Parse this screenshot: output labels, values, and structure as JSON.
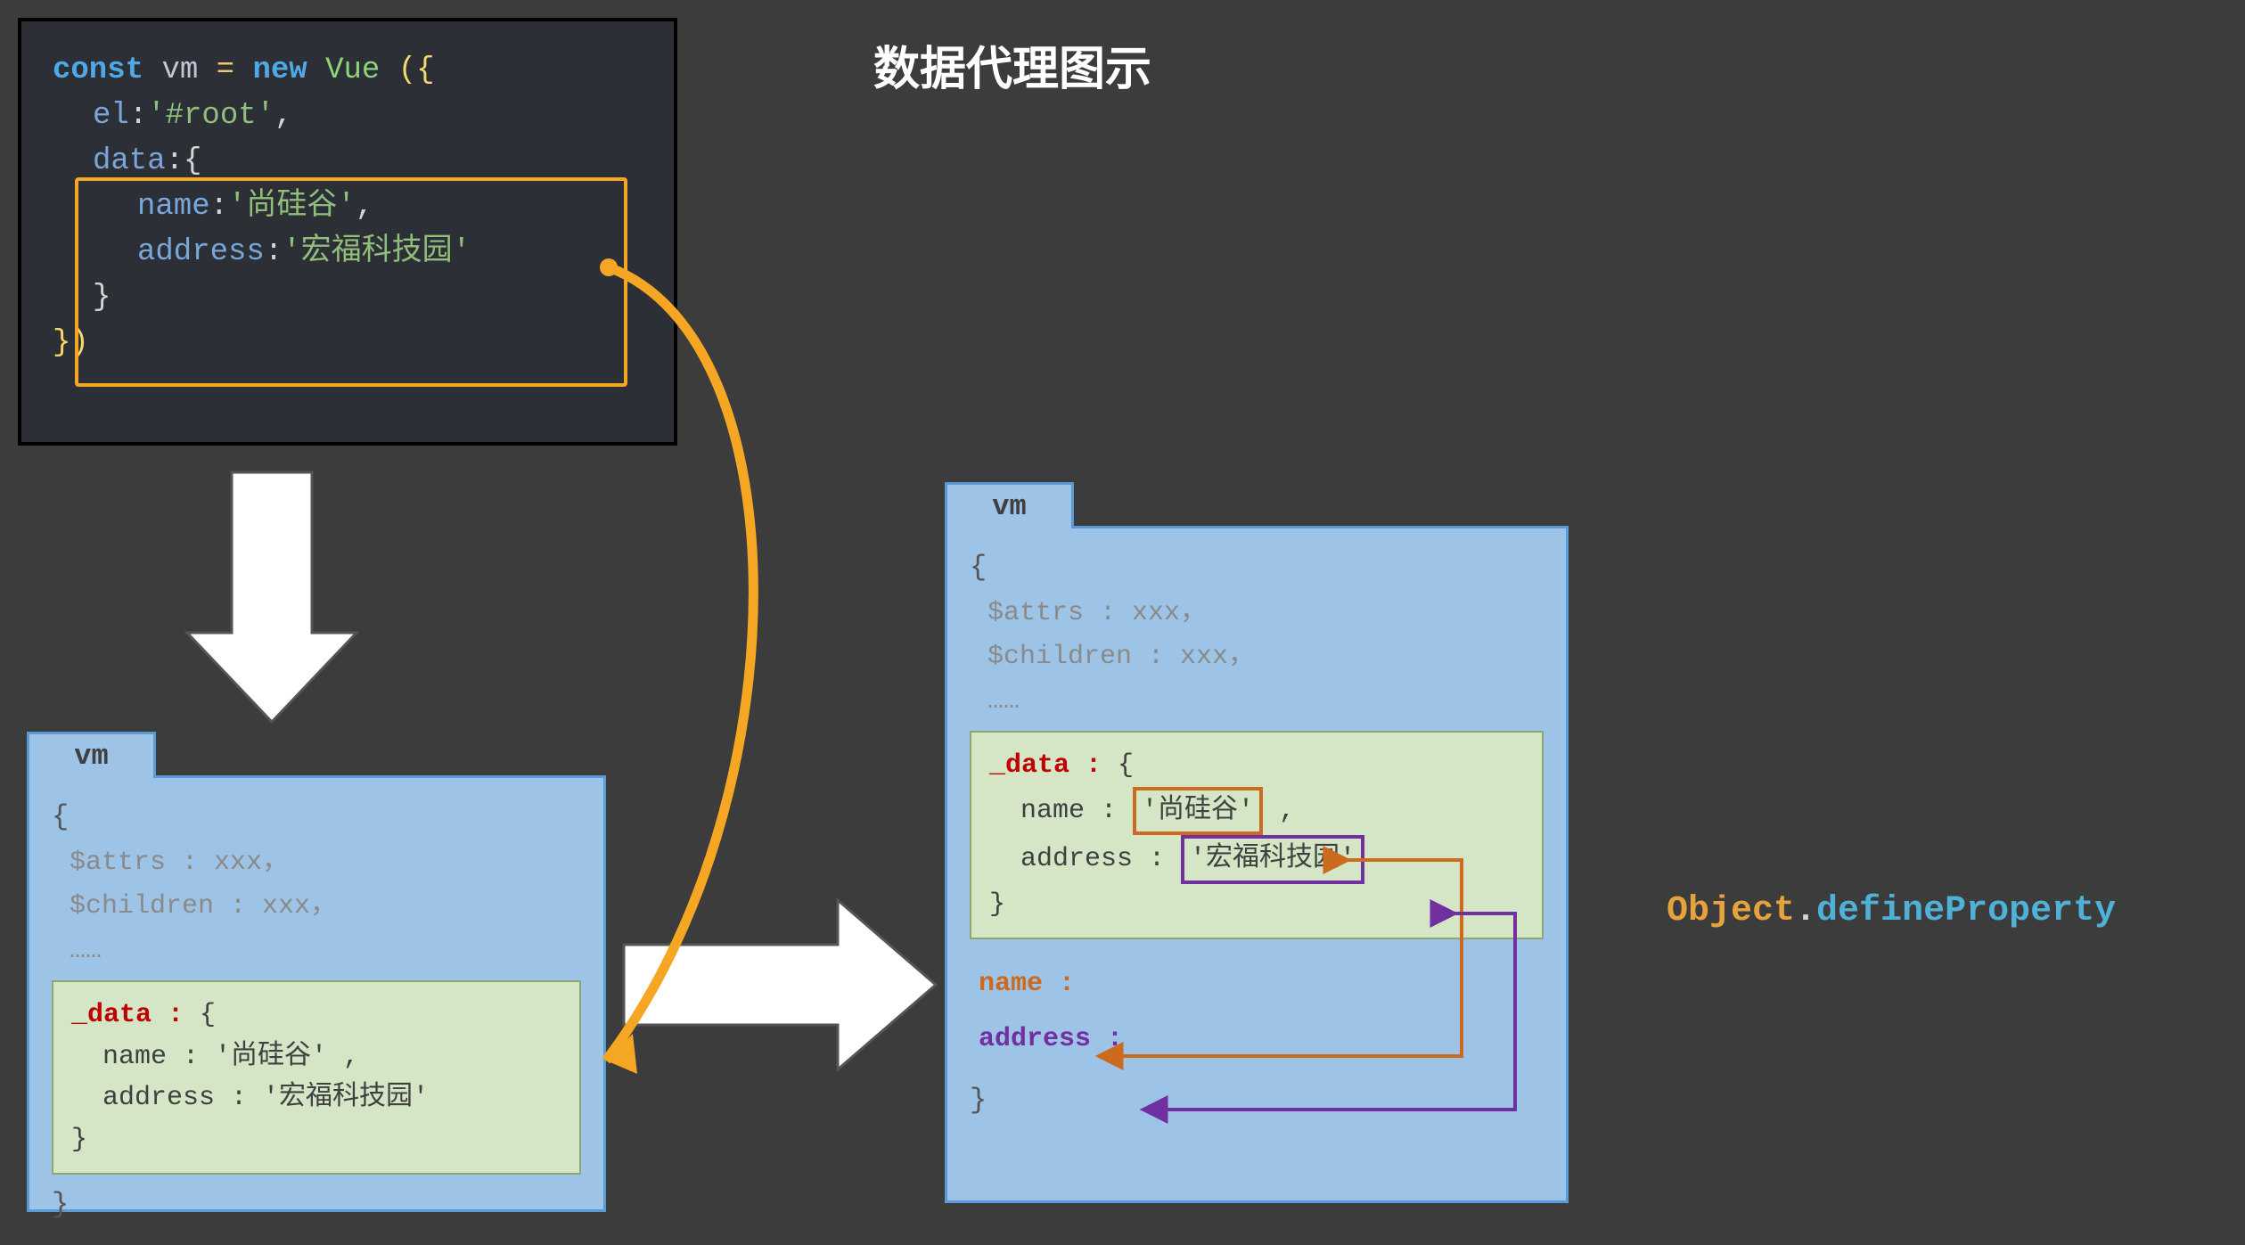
{
  "title": "数据代理图示",
  "code": {
    "const": "const",
    "vm": "vm",
    "eq": "=",
    "new": "new",
    "vue": "Vue",
    "lparen": "({",
    "el_key": "el",
    "el_val": "'#root'",
    "comma": ",",
    "data_key": "data",
    "colon_brace": ":{",
    "name_key": "name",
    "name_val": "'尚硅谷'",
    "address_key": "address",
    "address_val": "'宏福科技园'",
    "rbrace": "}",
    "rparen": "})"
  },
  "vm_left": {
    "tab": "vm",
    "brace_open": "{",
    "attrs": "$attrs : xxx，",
    "children": "$children : xxx，",
    "ellipsis": "……",
    "data_label": "_data :",
    "data_open": " {",
    "name_line": "name : '尚硅谷' ,",
    "address_line": "address : '宏福科技园'",
    "data_close": "}",
    "brace_close": "}"
  },
  "vm_right": {
    "tab": "vm",
    "brace_open": "{",
    "attrs": "$attrs : xxx，",
    "children": "$children : xxx，",
    "ellipsis": "……",
    "data_label": "_data :",
    "data_open": " {",
    "name_key": "name :",
    "name_val": "'尚硅谷'",
    "name_comma": " ,",
    "address_key": "address :",
    "address_val": "'宏福科技园'",
    "data_close": "}",
    "proxy_name": "name :",
    "proxy_address": "address :",
    "brace_close": "}"
  },
  "rhs": {
    "object": "Object",
    "dot": ".",
    "method": "defineProperty"
  }
}
